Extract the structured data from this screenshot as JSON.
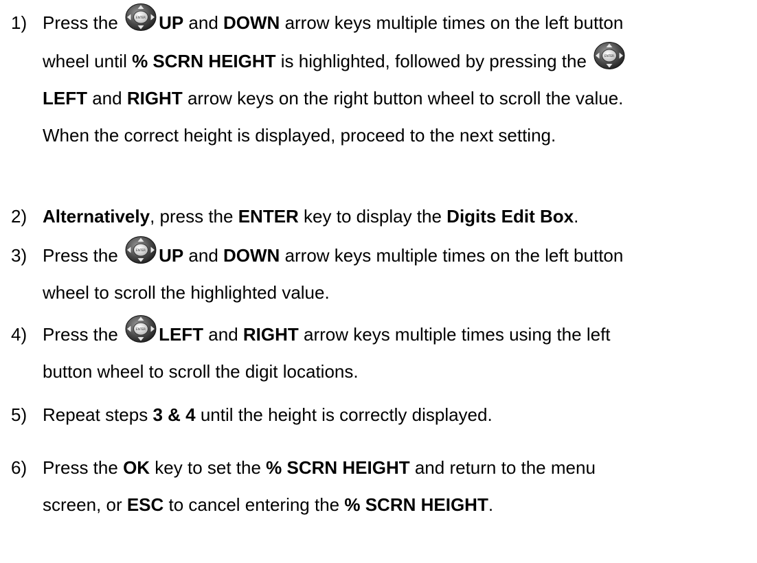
{
  "steps": [
    {
      "number": "1)",
      "lines": [
        [
          "Press the ",
          "UP",
          " and ",
          "DOWN",
          " arrow keys multiple times on the left button"
        ],
        [
          "wheel until ",
          "% SCRN HEIGHT",
          " is highlighted, followed by pressing the "
        ],
        [
          "LEFT",
          " and ",
          "RIGHT",
          " arrow keys on the right button wheel to scroll the value."
        ],
        [
          "When the correct height is displayed, proceed to the next setting."
        ]
      ]
    },
    {
      "number": "2)",
      "lines": [
        [
          "Alternatively",
          ", press the ",
          "ENTER",
          " key to display the ",
          "Digits Edit Box",
          "."
        ]
      ]
    },
    {
      "number": "3)",
      "lines": [
        [
          "Press the ",
          "UP",
          " and ",
          "DOWN",
          " arrow keys multiple times on the left button"
        ],
        [
          "wheel to scroll the highlighted value."
        ]
      ]
    },
    {
      "number": "4)",
      "lines": [
        [
          "Press the ",
          "LEFT",
          " and ",
          "RIGHT",
          " arrow keys multiple times using the left"
        ],
        [
          "button wheel to scroll the digit locations."
        ]
      ]
    },
    {
      "number": "5)",
      "lines": [
        [
          "Repeat steps ",
          "3 & 4",
          " until the height is correctly displayed."
        ]
      ]
    },
    {
      "number": "6)",
      "lines": [
        [
          "Press the ",
          "OK",
          " key to set the ",
          "% SCRN HEIGHT",
          " and return to the menu"
        ],
        [
          "screen, or ",
          "ESC",
          " to cancel entering the ",
          "% SCRN HEIGHT",
          "."
        ]
      ]
    }
  ],
  "icons": {
    "button_wheel": "button-wheel-icon",
    "center_label": "ENTER"
  }
}
